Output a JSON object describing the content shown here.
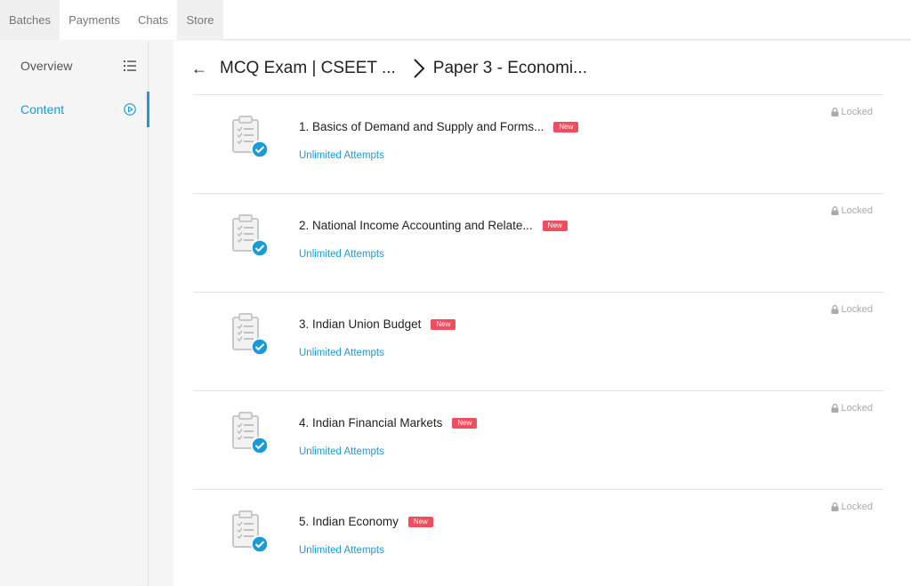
{
  "top_tabs": [
    {
      "label": "Batches"
    },
    {
      "label": "Payments"
    },
    {
      "label": "Chats"
    },
    {
      "label": "Store"
    }
  ],
  "sidebar": {
    "items": [
      {
        "label": "Overview",
        "icon": "list-icon"
      },
      {
        "label": "Content",
        "icon": "play-circle-icon"
      }
    ]
  },
  "breadcrumb": {
    "back_icon": "←",
    "crumb1": "MCQ Exam | CSEET ...",
    "crumb2": "Paper 3 - Economi..."
  },
  "content_items": [
    {
      "title": "1. Basics of Demand and Supply and Forms...",
      "badge": "New",
      "attempts": "Unlimited Attempts",
      "status": "Locked"
    },
    {
      "title": "2. National Income Accounting and Relate...",
      "badge": "New",
      "attempts": "Unlimited Attempts",
      "status": "Locked"
    },
    {
      "title": "3. Indian Union Budget",
      "badge": "New",
      "attempts": "Unlimited Attempts",
      "status": "Locked"
    },
    {
      "title": "4. Indian Financial Markets",
      "badge": "New",
      "attempts": "Unlimited Attempts",
      "status": "Locked"
    },
    {
      "title": "5. Indian Economy",
      "badge": "New",
      "attempts": "Unlimited Attempts",
      "status": "Locked"
    }
  ],
  "colors": {
    "accent": "#1a9bd7",
    "badge": "#f04d5e",
    "locked": "#aaaaaa"
  }
}
